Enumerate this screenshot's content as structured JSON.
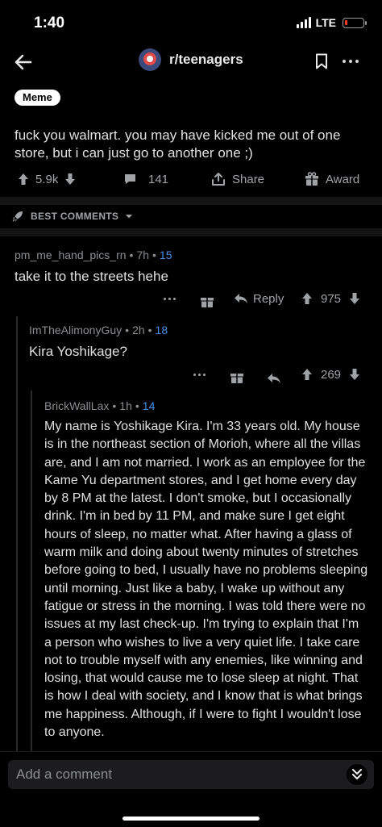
{
  "status_bar": {
    "time": "1:40",
    "network": "LTE",
    "battery_level": 0.1
  },
  "nav": {
    "subreddit": "r/teenagers",
    "icons": [
      "back-arrow-icon",
      "bookmark-icon",
      "more-icon"
    ]
  },
  "post": {
    "flair": "Meme",
    "text": "fuck you walmart. you may have kicked me out of one store, but i can just go to another one ;)",
    "score": "5.9k",
    "comments": "141",
    "share_label": "Share",
    "award_label": "Award"
  },
  "sort": {
    "label": "BEST COMMENTS"
  },
  "comments": [
    {
      "author": "pm_me_hand_pics_rn",
      "age": "7h",
      "children": "15",
      "body": "take it to the streets hehe",
      "reply_label": "Reply",
      "score": "975"
    },
    {
      "author": "ImTheAlimonyGuy",
      "age": "2h",
      "children": "18",
      "body": "Kira Yoshikage?",
      "score": "269"
    },
    {
      "author": "BrickWallLax",
      "age": "1h",
      "children": "14",
      "body": "My name is Yoshikage Kira. I'm 33 years old. My house is in the northeast section of Morioh, where all the villas are, and I am not married. I work as an employee for the Kame Yu department stores, and I get home every day by 8 PM at the latest. I don't smoke, but I occasionally drink. I'm in bed by 11 PM, and make sure I get eight hours of sleep, no matter what. After having a glass of warm milk and doing about twenty minutes of stretches before going to bed, I usually have no problems sleeping until morning. Just like a baby, I wake up without any fatigue or stress in the morning. I was told there were no issues at my last check-up. I'm trying to explain that I'm a person who wishes to live a very quiet life. I take care not to trouble myself with any enemies, like winning and losing, that would cause me to lose sleep at night. That is how I deal with society, and I know that is what brings me happiness. Although, if I were to fight I wouldn't lose to anyone."
    }
  ],
  "composer": {
    "placeholder": "Add a comment"
  }
}
